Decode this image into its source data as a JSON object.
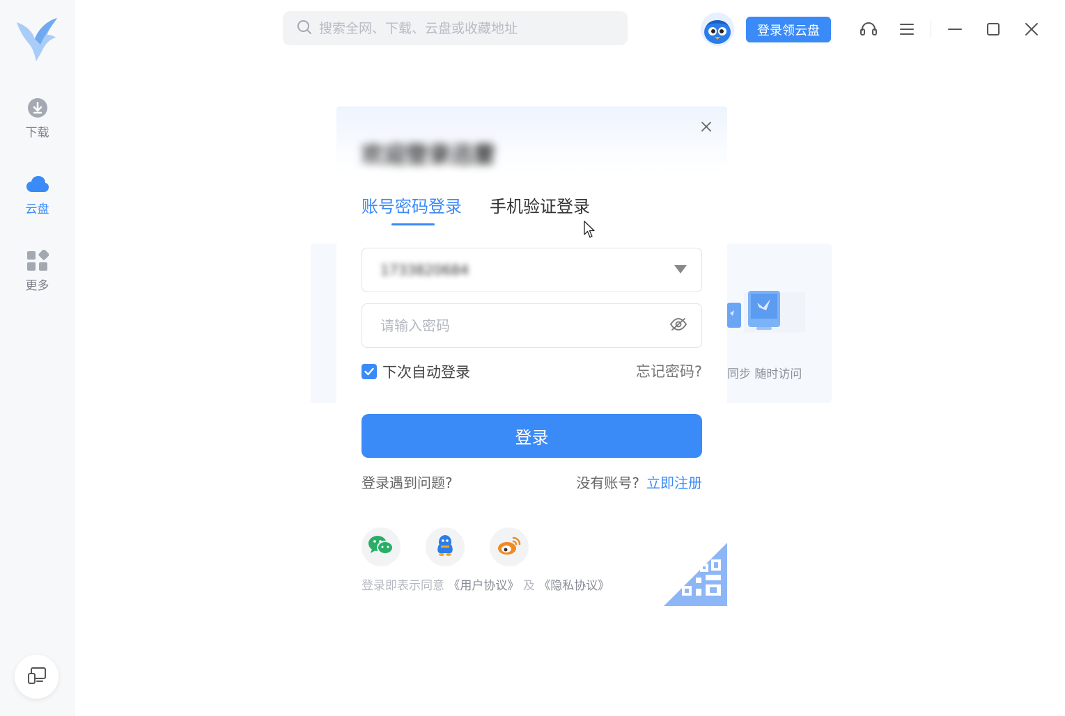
{
  "sidebar": {
    "items": [
      {
        "label": "下载",
        "icon": "download-icon"
      },
      {
        "label": "云盘",
        "icon": "cloud-icon"
      },
      {
        "label": "更多",
        "icon": "apps-icon"
      }
    ],
    "bottom_icon": "screen-mirror-icon"
  },
  "topbar": {
    "search_placeholder": "搜索全网、下载、云盘或收藏地址",
    "login_cloud_label": "登录领云盘",
    "icons": [
      "headset-icon",
      "menu-icon",
      "minimize-icon",
      "maximize-icon",
      "close-icon"
    ]
  },
  "background": {
    "card_text": "同步 随时访问"
  },
  "modal": {
    "title": "欢迎登录迅雷",
    "tabs": [
      {
        "label": "账号密码登录",
        "active": true
      },
      {
        "label": "手机验证登录",
        "active": false
      }
    ],
    "account_value": "1733820684",
    "password_placeholder": "请输入密码",
    "auto_login_label": "下次自动登录",
    "auto_login_checked": true,
    "forgot_label": "忘记密码?",
    "login_button": "登录",
    "problem_label": "登录遇到问题?",
    "no_account_label": "没有账号?",
    "register_label": "立即注册",
    "social": [
      "wechat-icon",
      "qq-icon",
      "weibo-icon"
    ],
    "agree_prefix": "登录即表示同意",
    "user_agreement": "《用户协议》",
    "and": "及",
    "privacy": "《隐私协议》"
  },
  "colors": {
    "accent": "#3a8af7",
    "sidebar_bg": "#f7f8fa",
    "text_muted": "#b4b8c0"
  }
}
